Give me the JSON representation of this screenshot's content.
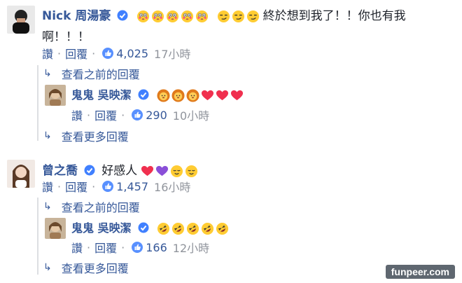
{
  "thread": {
    "comment1": {
      "author": "Nick 周湯豪",
      "text": "終於想到我了！！你也有我",
      "text_line2": "啊！！！",
      "emoji_before": [
        "flushed",
        "flushed",
        "flushed",
        "flushed",
        "flushed",
        "smirk",
        "smirk",
        "smirk"
      ],
      "like_label": "讚",
      "reply_label": "回覆",
      "likes": "4,025",
      "time": "17小時",
      "view_prev": "查看之前的回覆",
      "reply": {
        "author": "鬼鬼 吳映潔",
        "emoji": [
          "lion",
          "lion",
          "lion",
          "heart",
          "heart",
          "heart"
        ],
        "like_label": "讚",
        "reply_label": "回覆",
        "likes": "290",
        "time": "10小時"
      },
      "view_more": "查看更多回覆"
    },
    "comment2": {
      "author": "曾之喬",
      "text": "好感人",
      "emoji": [
        "heart",
        "purple-heart",
        "relieved",
        "relieved"
      ],
      "like_label": "讚",
      "reply_label": "回覆",
      "likes": "1,457",
      "time": "16小時",
      "view_prev": "查看之前的回覆",
      "reply": {
        "author": "鬼鬼 吳映潔",
        "emoji": [
          "rofl",
          "rofl",
          "rofl",
          "rofl",
          "rofl"
        ],
        "like_label": "讚",
        "reply_label": "回覆",
        "likes": "166",
        "time": "12小時"
      },
      "view_more": "查看更多回覆"
    }
  },
  "watermark": "funpeer.com",
  "colors": {
    "link": "#365899",
    "meta": "#90949c",
    "like_badge": "#5890ff",
    "heart": "#f0304f",
    "purple": "#8a4fd8",
    "emoji_yellow": "#ffcc33"
  }
}
